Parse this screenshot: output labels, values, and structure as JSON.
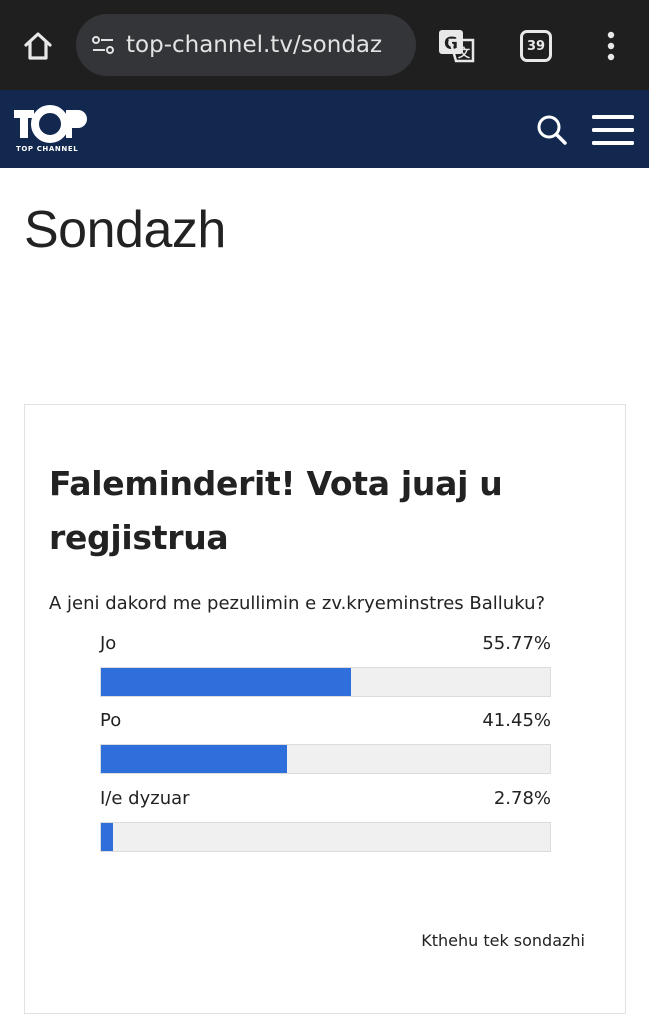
{
  "browser": {
    "url": "top-channel.tv/sondaz",
    "tab_count": "39"
  },
  "site": {
    "logo_text": "TOP CHANNEL"
  },
  "page": {
    "title": "Sondazh"
  },
  "poll": {
    "heading": "Faleminderit! Vota juaj u regjistrua",
    "question": "A jeni dakord me pezullimin e zv.kryeminstres Balluku?",
    "options": [
      {
        "label": "Jo",
        "percent_text": "55.77%",
        "percent": 55.77
      },
      {
        "label": "Po",
        "percent_text": "41.45%",
        "percent": 41.45
      },
      {
        "label": "I/e dyzuar",
        "percent_text": "2.78%",
        "percent": 2.78
      }
    ],
    "back_link": "Kthehu tek sondazhi"
  },
  "colors": {
    "bar_fill": "#2e6fdc",
    "header_bg": "#13284f",
    "chrome_bg": "#1f1f1f"
  },
  "icons": [
    "home-icon",
    "site-settings-icon",
    "translate-icon",
    "tab-switcher-icon",
    "more-vert-icon",
    "search-icon",
    "hamburger-menu-icon"
  ]
}
